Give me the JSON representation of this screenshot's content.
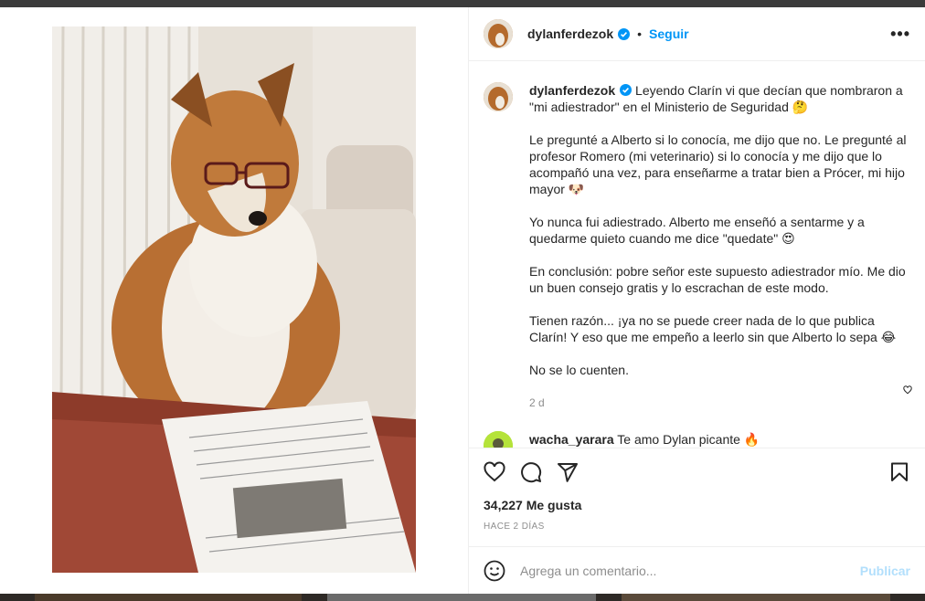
{
  "post": {
    "username": "dylanferdezok",
    "follow_label": "Seguir",
    "more_label": "•••"
  },
  "caption": {
    "username": "dylanferdezok",
    "paragraphs": [
      "Leyendo Clarín vi que decían que nombraron a \"mi adiestrador\" en el Ministerio de Seguridad 🤔",
      "Le pregunté a Alberto si lo conocía, me dijo que no. Le pregunté al profesor Romero (mi veterinario) si lo conocía y me dijo que lo acompañó una vez, para enseñarme a tratar bien a Prócer, mi hijo mayor 🐶",
      "Yo nunca fui adiestrado. Alberto me enseñó a sentarme y a quedarme quieto cuando me dice \"quedate\" 😍",
      "En conclusión: pobre señor este supuesto adiestrador mío. Me dio un buen consejo gratis y lo escrachan de este modo.",
      "Tienen razón... ¡ya no se puede creer nada de lo que publica Clarín! Y eso que me empeño a leerlo sin que Alberto lo sepa 😂",
      "No se lo cuenten."
    ],
    "age": "2 d"
  },
  "comment": {
    "username": "wacha_yarara",
    "text": "Te amo Dylan picante 🔥"
  },
  "stats": {
    "likes": "34,227 Me gusta",
    "posted": "HACE 2 DÍAS"
  },
  "compose": {
    "placeholder": "Agrega un comentario...",
    "publish_label": "Publicar"
  },
  "icons": [
    "verified-icon",
    "more-icon",
    "heart-icon",
    "comment-icon",
    "share-icon",
    "bookmark-icon",
    "emoji-icon"
  ],
  "colors": {
    "link": "#0095f6",
    "verified": "#0095f6",
    "secondary_text": "#8e8e8e",
    "publish_disabled": "#b2dffc"
  }
}
